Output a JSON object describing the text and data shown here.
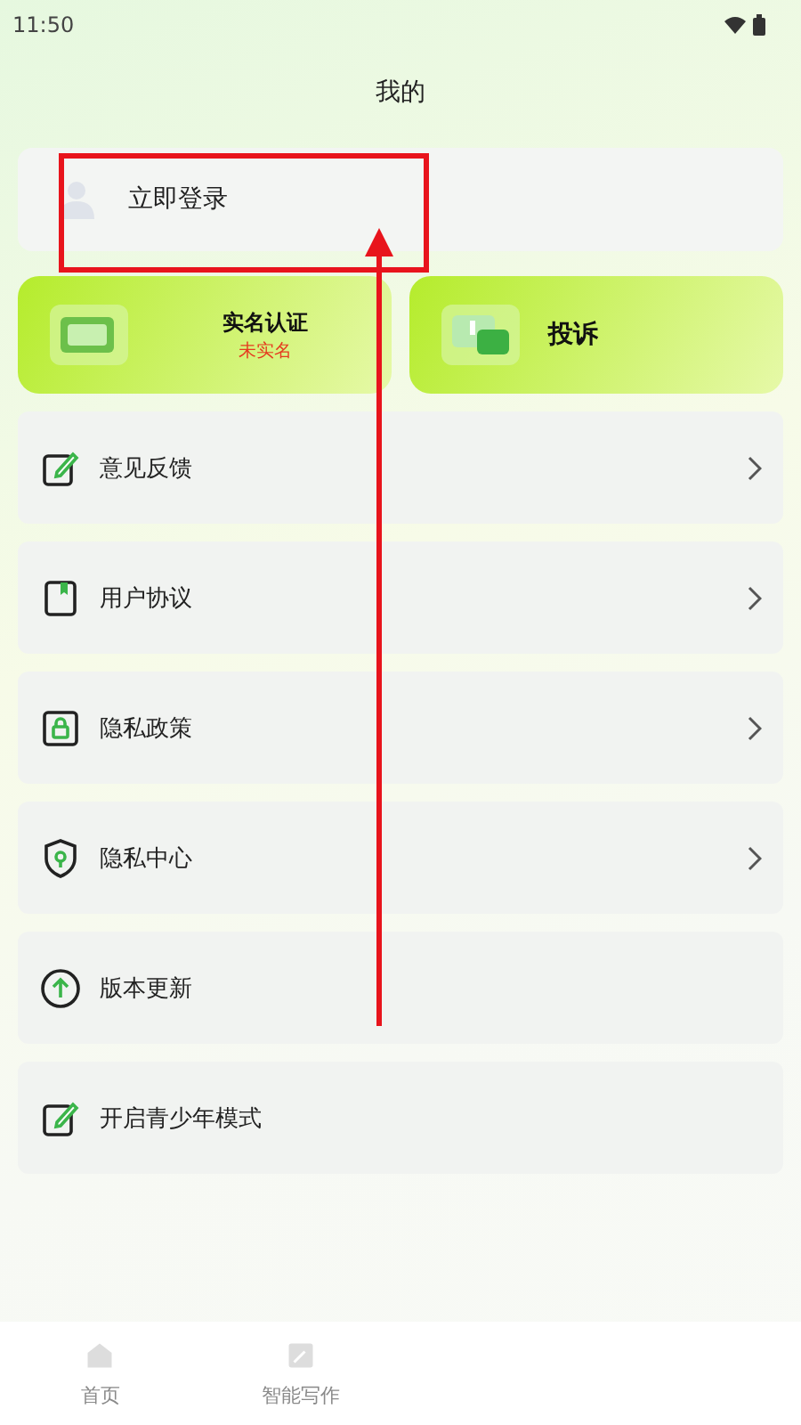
{
  "status_bar": {
    "time": "11:50"
  },
  "header": {
    "title": "我的"
  },
  "login": {
    "label": "立即登录"
  },
  "cards": [
    {
      "kind": "id",
      "title": "实名认证",
      "status": "未实名"
    },
    {
      "kind": "complaint",
      "title": "投诉"
    }
  ],
  "menu": [
    {
      "kind": "feedback",
      "label": "意见反馈",
      "chevron": true
    },
    {
      "kind": "agreement",
      "label": "用户协议",
      "chevron": true
    },
    {
      "kind": "privacy",
      "label": "隐私政策",
      "chevron": true
    },
    {
      "kind": "center",
      "label": "隐私中心",
      "chevron": true
    },
    {
      "kind": "update",
      "label": "版本更新",
      "chevron": false
    },
    {
      "kind": "mode",
      "label": "开启青少年模式",
      "chevron": false
    }
  ],
  "bottom_nav": [
    {
      "kind": "home",
      "label": "首页"
    },
    {
      "kind": "write",
      "label": "智能写作"
    }
  ],
  "annotation": {
    "kind": "highlight-with-arrow"
  }
}
